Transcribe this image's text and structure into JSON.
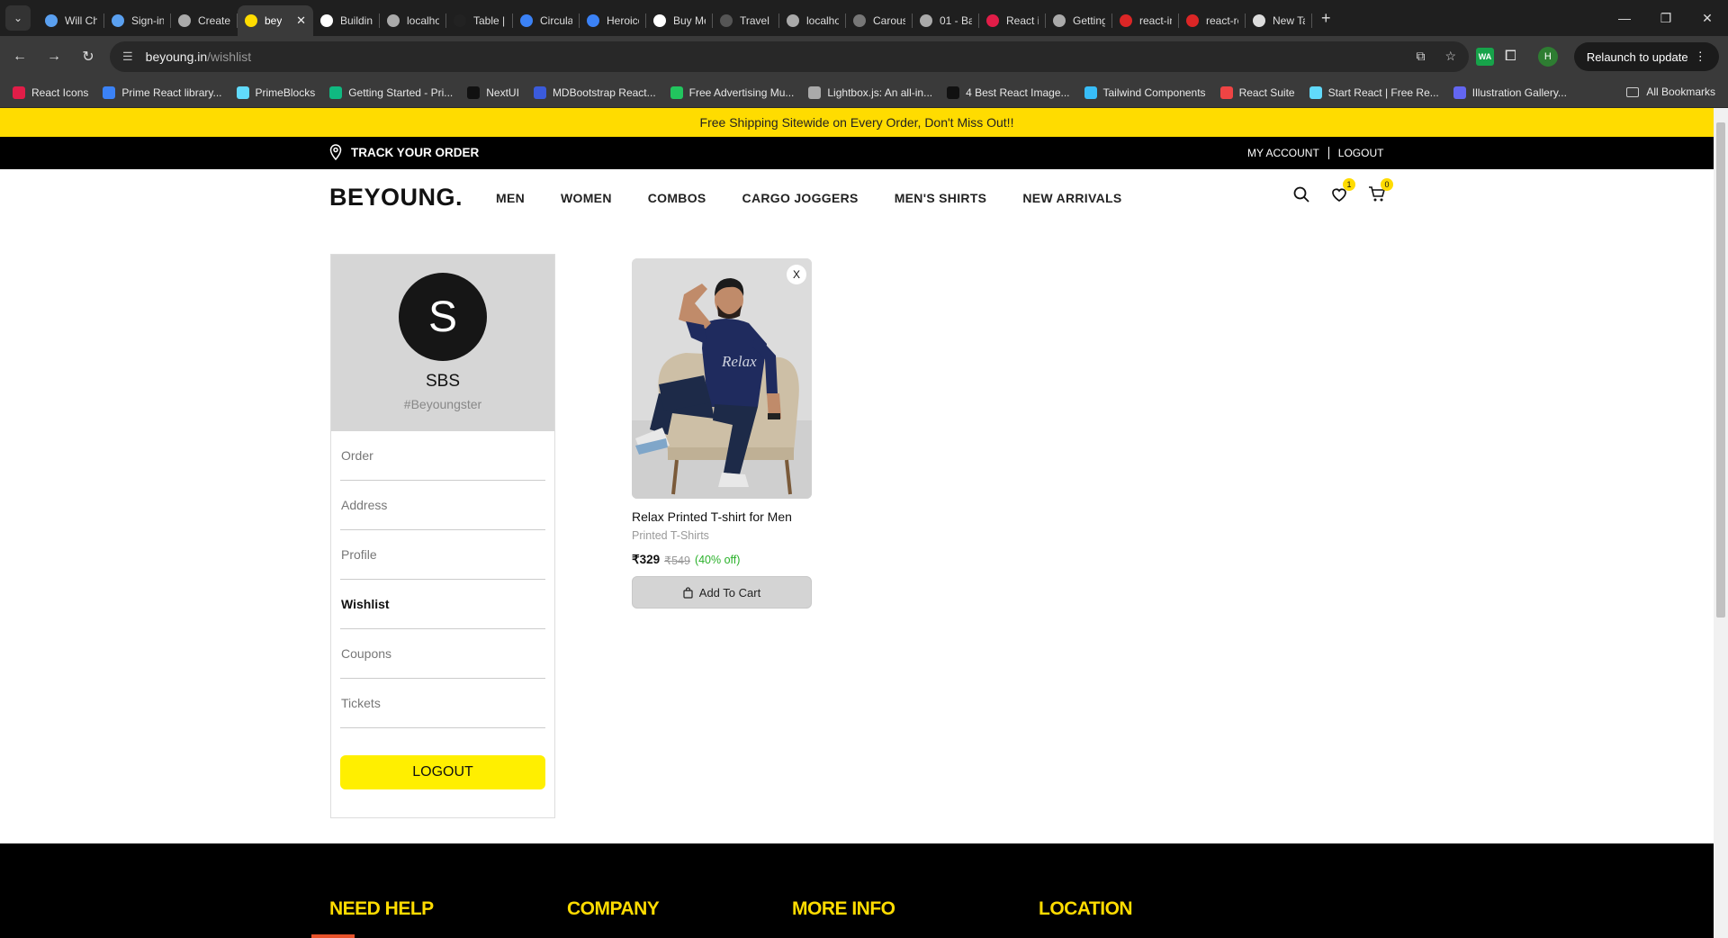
{
  "browser": {
    "tabs": [
      {
        "title": "Will Cha",
        "fav": "#5aa0f0"
      },
      {
        "title": "Sign-in",
        "fav": "#5aa0f0"
      },
      {
        "title": "Create F",
        "fav": "#aaaaaa"
      },
      {
        "title": "bey",
        "fav": "#ffdc00",
        "active": true
      },
      {
        "title": "Building",
        "fav": "#ffffff"
      },
      {
        "title": "localho",
        "fav": "#aaaaaa"
      },
      {
        "title": "Table | I",
        "fav": "#222222"
      },
      {
        "title": "Circular",
        "fav": "#3b82f6"
      },
      {
        "title": "Heroico",
        "fav": "#3b82f6"
      },
      {
        "title": "Buy Me",
        "fav": "#ffffff"
      },
      {
        "title": "Travel M",
        "fav": "#555555"
      },
      {
        "title": "localho",
        "fav": "#aaaaaa"
      },
      {
        "title": "Carouse",
        "fav": "#777777"
      },
      {
        "title": "01 - Ba",
        "fav": "#aaaaaa"
      },
      {
        "title": "React ic",
        "fav": "#e11d48"
      },
      {
        "title": "Getting",
        "fav": "#aaaaaa"
      },
      {
        "title": "react-in",
        "fav": "#dc2626"
      },
      {
        "title": "react-re",
        "fav": "#dc2626"
      },
      {
        "title": "New Ta",
        "fav": "#dddddd"
      }
    ],
    "url_host": "beyoung.in",
    "url_path": "/wishlist",
    "relaunch_label": "Relaunch to update",
    "profile_initial": "H",
    "ext_label": "WA",
    "bookmarks": [
      {
        "label": "React Icons",
        "color": "#e11d48"
      },
      {
        "label": "Prime React library...",
        "color": "#3b82f6"
      },
      {
        "label": "PrimeBlocks",
        "color": "#61dafb"
      },
      {
        "label": "Getting Started - Pri...",
        "color": "#10b981"
      },
      {
        "label": "NextUI",
        "color": "#111111"
      },
      {
        "label": "MDBootstrap React...",
        "color": "#3b5bdb"
      },
      {
        "label": "Free Advertising Mu...",
        "color": "#22c55e"
      },
      {
        "label": "Lightbox.js: An all-in...",
        "color": "#aaaaaa"
      },
      {
        "label": "4 Best React Image...",
        "color": "#111111"
      },
      {
        "label": "Tailwind Components",
        "color": "#38bdf8"
      },
      {
        "label": "React Suite",
        "color": "#ef4444"
      },
      {
        "label": "Start React | Free Re...",
        "color": "#61dafb"
      },
      {
        "label": "Illustration Gallery...",
        "color": "#6366f1"
      }
    ],
    "all_bookmarks": "All Bookmarks"
  },
  "site": {
    "announcement": "Free Shipping Sitewide on Every Order, Don't Miss Out!!",
    "track_order": "TRACK YOUR ORDER",
    "my_account": "MY ACCOUNT",
    "logout_top": "LOGOUT",
    "logo": "BEYOUNG",
    "logo_dot": ".",
    "menu": [
      "MEN",
      "WOMEN",
      "COMBOS",
      "CARGO JOGGERS",
      "MEN'S SHIRTS",
      "NEW ARRIVALS"
    ],
    "wishlist_count": "1",
    "cart_count": "0"
  },
  "sidebar": {
    "initial": "S",
    "name": "SBS",
    "tag": "#Beyoungster",
    "items": [
      "Order",
      "Address",
      "Profile",
      "Wishlist",
      "Coupons",
      "Tickets"
    ],
    "active_item": "Wishlist",
    "logout": "LOGOUT"
  },
  "wishlist": {
    "product": {
      "remove": "X",
      "name": "Relax Printed T-shirt for Men",
      "category": "Printed T-Shirts",
      "price": "₹329",
      "mrp": "₹549",
      "discount": "(40% off)",
      "add_to_cart": "Add To Cart",
      "print_text": "Relax"
    }
  },
  "footer": {
    "headings": [
      "NEED HELP",
      "COMPANY",
      "MORE INFO",
      "LOCATION"
    ]
  }
}
